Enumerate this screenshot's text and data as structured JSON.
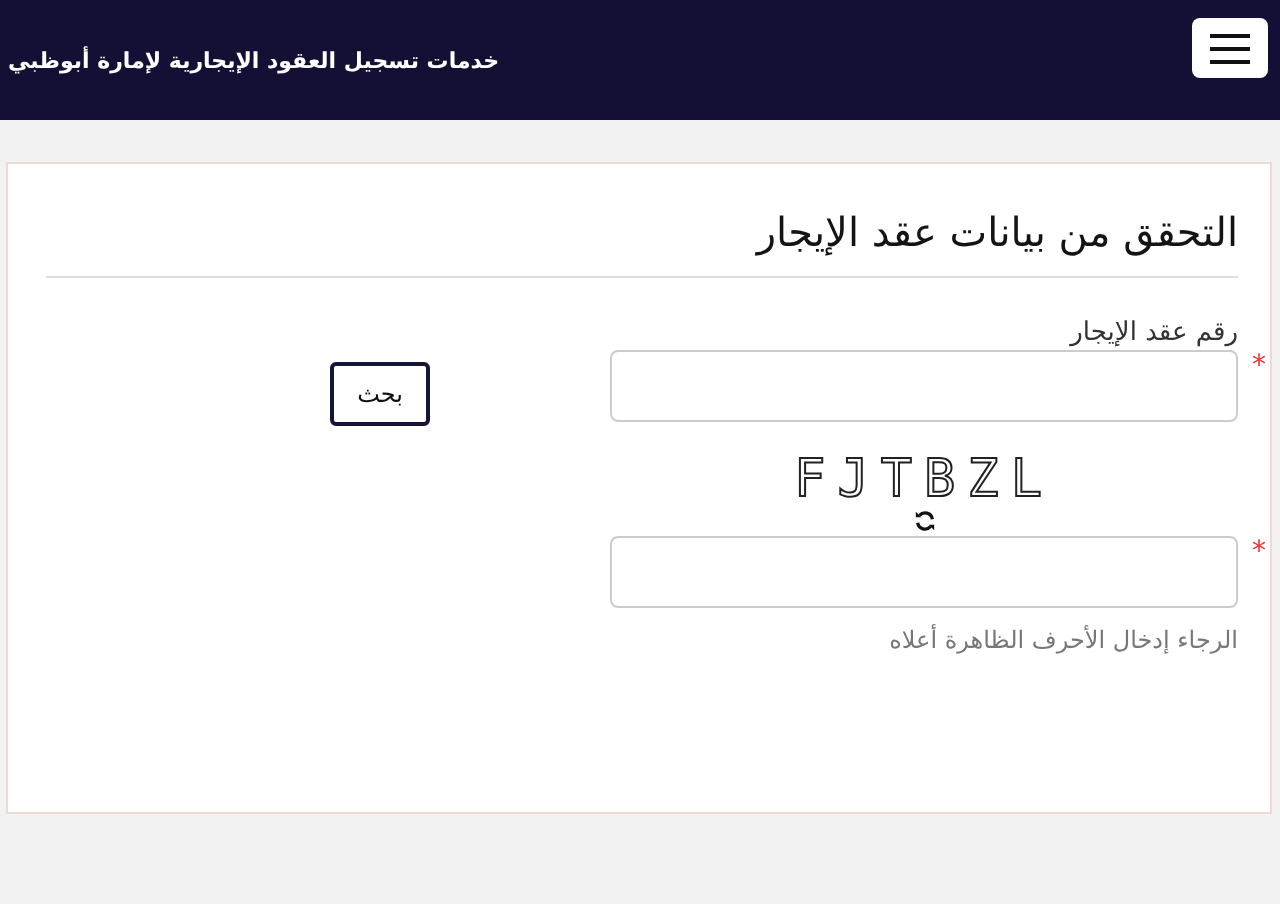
{
  "header": {
    "title": "خدمات تسجيل العقود الإيجارية لإمارة أبوظبي"
  },
  "form": {
    "title": "التحقق من بيانات عقد الإيجار",
    "contract_field": {
      "label": "رقم عقد الإيجار",
      "required_mark": "*"
    },
    "search_button": "بحث",
    "captcha": {
      "code": "FJTBZL"
    },
    "captcha_field": {
      "required_mark": "*",
      "help": "الرجاء إدخال الأحرف الظاهرة أعلاه"
    }
  }
}
